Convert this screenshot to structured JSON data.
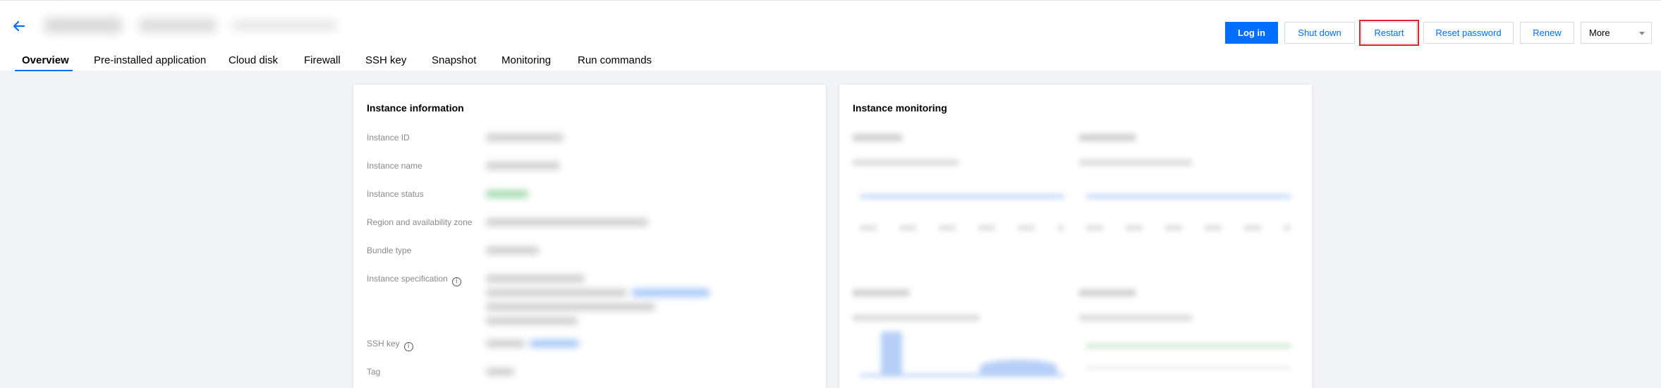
{
  "header": {
    "actions": {
      "login": "Log in",
      "shutdown": "Shut down",
      "restart": "Restart",
      "reset_password": "Reset password",
      "renew": "Renew",
      "more": "More"
    }
  },
  "tabs": [
    {
      "label": "Overview",
      "active": true
    },
    {
      "label": "Pre-installed application"
    },
    {
      "label": "Cloud disk"
    },
    {
      "label": "Firewall"
    },
    {
      "label": "SSH key"
    },
    {
      "label": "Snapshot"
    },
    {
      "label": "Monitoring"
    },
    {
      "label": "Run commands"
    }
  ],
  "instance_info": {
    "title": "Instance information",
    "rows": [
      "Instance ID",
      "Instance name",
      "Instance status",
      "Region and availability zone",
      "Bundle type",
      "Instance specification",
      "SSH key",
      "Tag"
    ]
  },
  "monitoring": {
    "title": "Instance monitoring"
  },
  "colors": {
    "accent": "#006eff",
    "highlight": "#e0242c",
    "background": "#f2f3f7"
  }
}
